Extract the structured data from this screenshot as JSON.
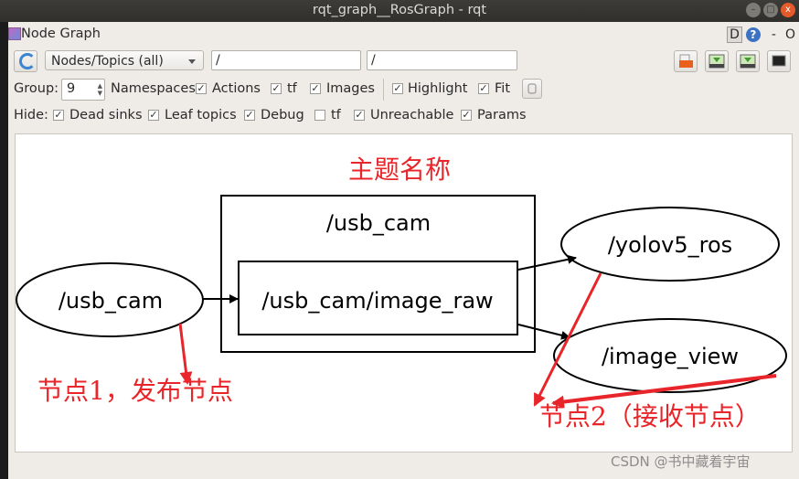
{
  "window": {
    "title": "rqt_graph__RosGraph - rqt"
  },
  "plugin": {
    "title": "Node Graph",
    "d_label": "D",
    "help_label": "?",
    "dash_label": "-",
    "o_label": "O"
  },
  "toolbar": {
    "mode_value": "Nodes/Topics (all)",
    "node_filter_value": "/",
    "topic_filter_value": "/"
  },
  "group_row": {
    "group_label": "Group:",
    "group_value": "9",
    "namespaces_label": "Namespaces",
    "options": [
      {
        "label": "Actions",
        "checked": true
      },
      {
        "label": "tf",
        "checked": true
      },
      {
        "label": "Images",
        "checked": true
      },
      {
        "label": "Highlight",
        "checked": true
      },
      {
        "label": "Fit",
        "checked": true
      }
    ]
  },
  "hide_row": {
    "hide_label": "Hide:",
    "options": [
      {
        "label": "Dead sinks",
        "checked": true
      },
      {
        "label": "Leaf topics",
        "checked": true
      },
      {
        "label": "Debug",
        "checked": true
      },
      {
        "label": "tf",
        "checked": false
      },
      {
        "label": "Unreachable",
        "checked": true
      },
      {
        "label": "Params",
        "checked": true
      }
    ]
  },
  "graph": {
    "nodes": [
      {
        "id": "usb_cam",
        "label": "/usb_cam",
        "type": "node"
      },
      {
        "id": "yolov5_ros",
        "label": "/yolov5_ros",
        "type": "node"
      },
      {
        "id": "image_view",
        "label": "/image_view",
        "type": "node"
      }
    ],
    "namespace_box": {
      "label": "/usb_cam"
    },
    "topic": {
      "label": "/usb_cam/image_raw"
    },
    "edges": [
      {
        "from": "/usb_cam",
        "to": "/usb_cam/image_raw"
      },
      {
        "from": "/usb_cam/image_raw",
        "to": "/yolov5_ros"
      },
      {
        "from": "/usb_cam/image_raw",
        "to": "/image_view"
      }
    ]
  },
  "annotations": {
    "topic_name": "主题名称",
    "node1": "节点1，发布节点",
    "node2": "节点2（接收节点）",
    "color": "#e8252a"
  },
  "watermark": "CSDN @书中藏着宇宙"
}
